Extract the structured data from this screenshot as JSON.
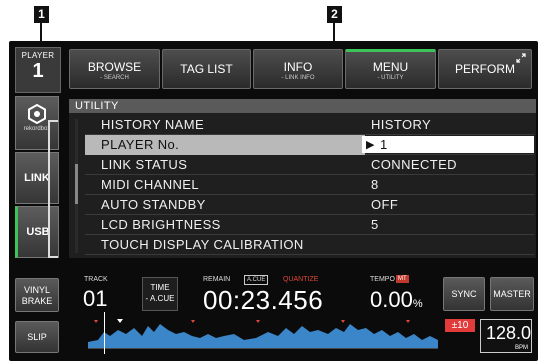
{
  "callouts": [
    "1",
    "2"
  ],
  "player": {
    "label": "PLAYER",
    "number": "1"
  },
  "top_buttons": [
    {
      "label": "BROWSE",
      "sub": "- SEARCH"
    },
    {
      "label": "TAG LIST",
      "sub": ""
    },
    {
      "label": "INFO",
      "sub": "- LINK INFO"
    },
    {
      "label": "MENU",
      "sub": "- UTILITY"
    },
    {
      "label": "PERFORM",
      "sub": ""
    }
  ],
  "side_tabs": {
    "rekordbox": "rekordbox",
    "link": "LINK",
    "usb": "USB"
  },
  "utility": {
    "title": "UTILITY",
    "rows": [
      {
        "name": "HISTORY NAME",
        "value": "HISTORY"
      },
      {
        "name": "PLAYER No.",
        "value": "1"
      },
      {
        "name": "LINK STATUS",
        "value": "CONNECTED"
      },
      {
        "name": "MIDI CHANNEL",
        "value": "8"
      },
      {
        "name": "AUTO STANDBY",
        "value": "OFF"
      },
      {
        "name": "LCD BRIGHTNESS",
        "value": "5"
      },
      {
        "name": "TOUCH DISPLAY CALIBRATION",
        "value": ""
      }
    ]
  },
  "deck": {
    "vinyl_brake": [
      "VINYL",
      "BRAKE"
    ],
    "slip": "SLIP",
    "track_label": "TRACK",
    "track_number": "01",
    "time_button": [
      "TIME",
      "- A.CUE"
    ],
    "remain_label": "REMAIN",
    "acue_tag": "A.CUE",
    "quantize_label": "QUANTIZE",
    "remain_time": "00:23.456",
    "tempo_label": "TEMPO",
    "mt_tag": "MT",
    "tempo_value": "0.00",
    "tempo_unit": "%",
    "sync": "SYNC",
    "master": "MASTER",
    "range": "±10",
    "bpm_value": "128.0",
    "bpm_unit": "BPM"
  },
  "colors": {
    "accent_green": "#3ec35a",
    "waveform_blue": "#3a86c8",
    "warning_red": "#e23b3b"
  },
  "icons": {
    "rekordbox": "rekordbox-logo-icon",
    "expand": "expand-arrows-icon"
  }
}
